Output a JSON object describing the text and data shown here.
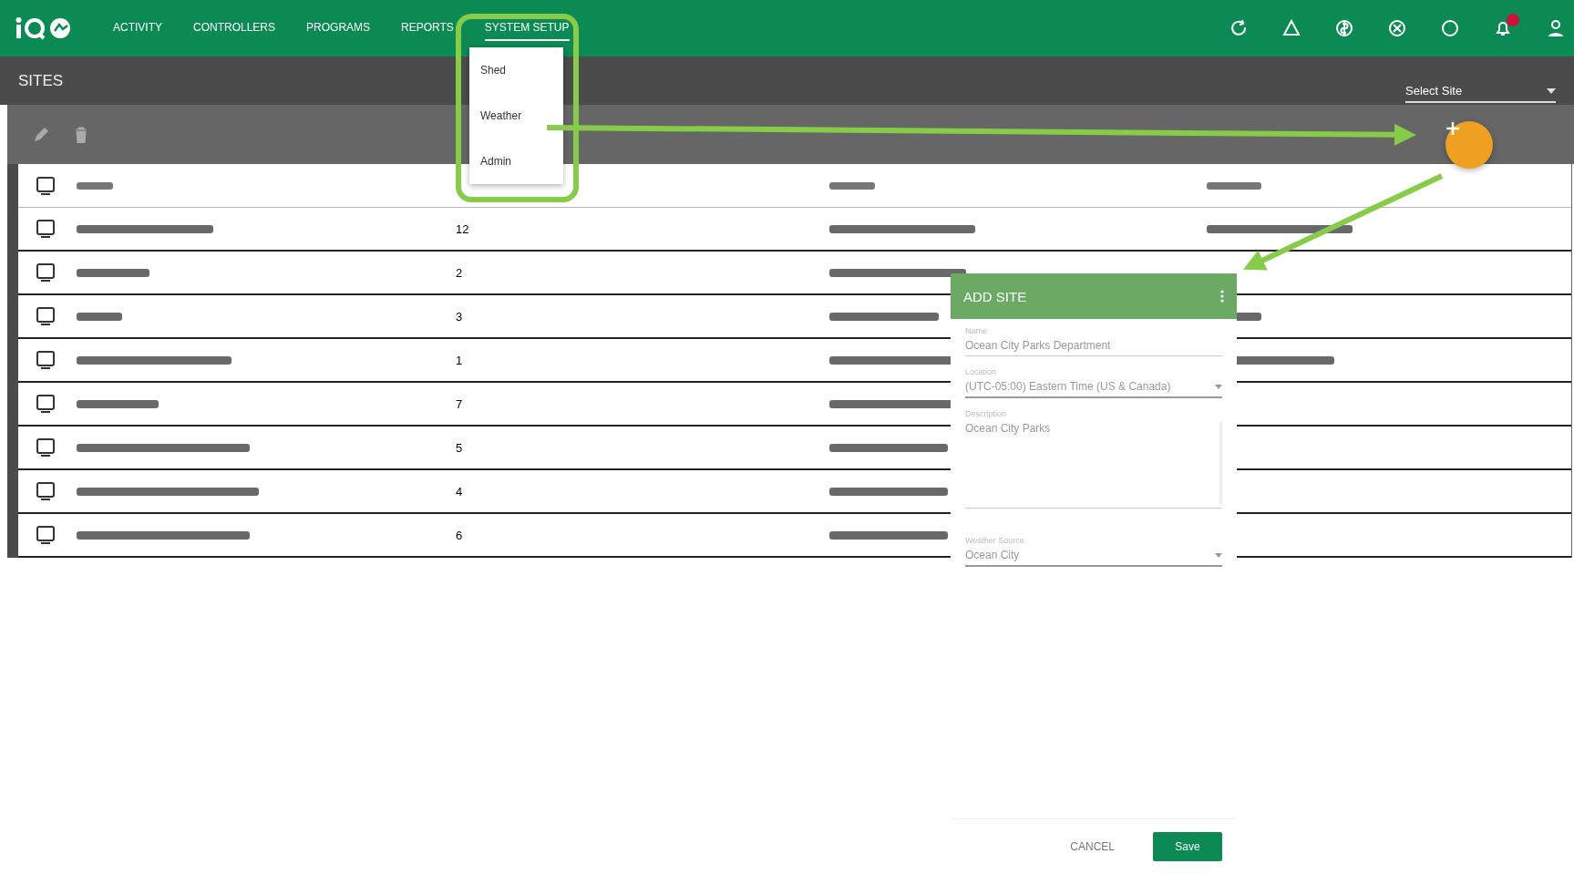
{
  "nav": {
    "items": [
      {
        "label": "ACTIVITY",
        "selected": false
      },
      {
        "label": "CONTROLLERS",
        "selected": false
      },
      {
        "label": "PROGRAMS",
        "selected": false
      },
      {
        "label": "REPORTS",
        "selected": false
      },
      {
        "label": "SYSTEM SETUP",
        "selected": true
      }
    ]
  },
  "menu": {
    "items": [
      "Shed",
      "Weather",
      "Admin"
    ]
  },
  "page_title": "SITES",
  "site_select": {
    "placeholder": "Select Site"
  },
  "table": {
    "rows": [
      {
        "count": "12"
      },
      {
        "count": "2"
      },
      {
        "count": "3"
      },
      {
        "count": "1"
      },
      {
        "count": "7"
      },
      {
        "count": "5"
      },
      {
        "count": "4"
      },
      {
        "count": "6"
      }
    ]
  },
  "dialog": {
    "title": "ADD SITE",
    "fields": [
      {
        "kind": "text",
        "label": "Name",
        "value": "Ocean City Parks Department"
      },
      {
        "kind": "select",
        "label": "Location",
        "value": "(UTC-05:00) Eastern Time (US & Canada)"
      },
      {
        "kind": "textarea",
        "label": "Description",
        "value": "Ocean City Parks"
      },
      {
        "kind": "select",
        "label": "Weather Source",
        "value": "Ocean City"
      }
    ],
    "cancel": "CANCEL",
    "save": "Save"
  }
}
